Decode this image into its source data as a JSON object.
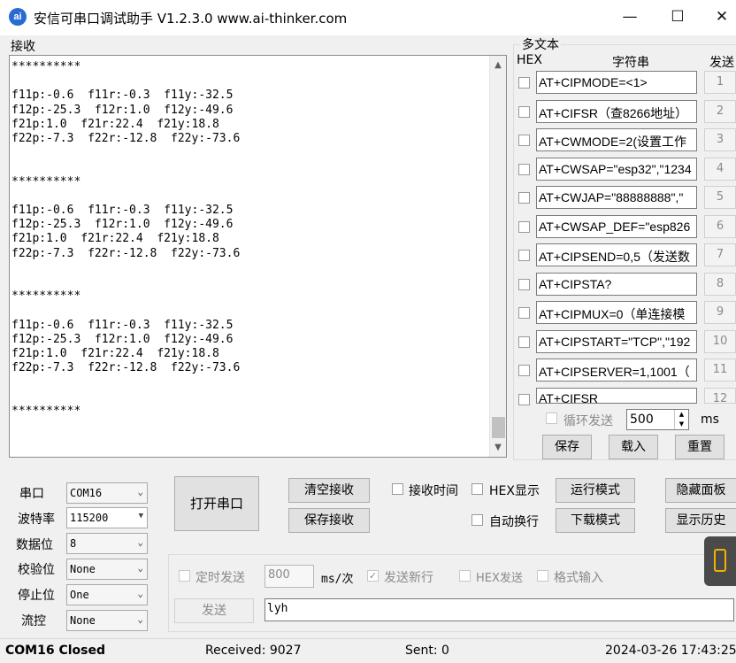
{
  "window": {
    "logo_text": "ai",
    "title": "安信可串口调试助手 V1.2.3.0    www.ai-thinker.com",
    "min_glyph": "—",
    "max_glyph": "☐",
    "close_glyph": "✕"
  },
  "receive": {
    "label": "接收",
    "text": "**********\n\nf11p:-0.6  f11r:-0.3  f11y:-32.5\nf12p:-25.3  f12r:1.0  f12y:-49.6\nf21p:1.0  f21r:22.4  f21y:18.8\nf22p:-7.3  f22r:-12.8  f22y:-73.6\n\n\n**********\n\nf11p:-0.6  f11r:-0.3  f11y:-32.5\nf12p:-25.3  f12r:1.0  f12y:-49.6\nf21p:1.0  f21r:22.4  f21y:18.8\nf22p:-7.3  f22r:-12.8  f22y:-73.6\n\n\n**********\n\nf11p:-0.6  f11r:-0.3  f11y:-32.5\nf12p:-25.3  f12r:1.0  f12y:-49.6\nf21p:1.0  f21r:22.4  f21y:18.8\nf22p:-7.3  f22r:-12.8  f22y:-73.6\n\n\n**********"
  },
  "multi": {
    "title": "多文本",
    "hex_header": "HEX",
    "string_header": "字符串",
    "send_header": "发送",
    "rows": [
      {
        "text": "AT+CIPMODE=<1>",
        "num": "1"
      },
      {
        "text": "AT+CIFSR（查8266地址）",
        "num": "2"
      },
      {
        "text": "AT+CWMODE=2(设置工作",
        "num": "3"
      },
      {
        "text": "AT+CWSAP=\"esp32\",\"1234",
        "num": "4"
      },
      {
        "text": "AT+CWJAP=\"88888888\",\"",
        "num": "5"
      },
      {
        "text": "AT+CWSAP_DEF=\"esp826",
        "num": "6"
      },
      {
        "text": "AT+CIPSEND=0,5（发送数",
        "num": "7"
      },
      {
        "text": "AT+CIPSTA?",
        "num": "8"
      },
      {
        "text": "AT+CIPMUX=0（单连接模",
        "num": "9"
      },
      {
        "text": "AT+CIPSTART=\"TCP\",\"192",
        "num": "10"
      },
      {
        "text": "AT+CIPSERVER=1,1001（",
        "num": "11"
      },
      {
        "text": "AT+CIFSR",
        "num": "12"
      }
    ],
    "loop_label": "循环发送",
    "loop_interval": "500",
    "loop_unit": "ms",
    "save": "保存",
    "load": "载入",
    "reset": "重置"
  },
  "settings": {
    "port_label": "串口",
    "port_value": "COM16",
    "baud_label": "波特率",
    "baud_value": "115200",
    "databits_label": "数据位",
    "databits_value": "8",
    "parity_label": "校验位",
    "parity_value": "None",
    "stopbits_label": "停止位",
    "stopbits_value": "One",
    "flow_label": "流控",
    "flow_value": "None"
  },
  "controls": {
    "open_port": "打开串口",
    "clear_recv": "清空接收",
    "save_recv": "保存接收",
    "recv_time": "接收时间",
    "hex_display": "HEX显示",
    "run_mode": "运行模式",
    "hide_panel": "隐藏面板",
    "auto_wrap": "自动换行",
    "download_mode": "下载模式",
    "show_history": "显示历史"
  },
  "send": {
    "timed_label": "定时发送",
    "interval": "800",
    "interval_unit": "ms/次",
    "newline_label": "发送新行",
    "hex_send_label": "HEX发送",
    "format_input_label": "格式输入",
    "send_button": "发送",
    "input_value": "lyh"
  },
  "status": {
    "port_state": "COM16 Closed",
    "received": "Received: 9027",
    "sent": "Sent: 0",
    "datetime": "2024-03-26 17:43:25"
  }
}
